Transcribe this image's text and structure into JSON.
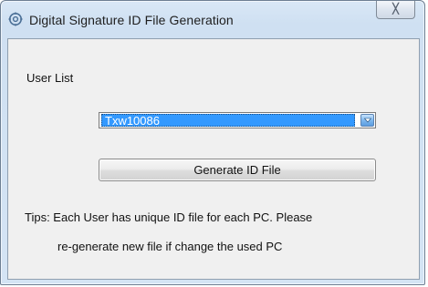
{
  "window": {
    "title": "Digital Signature ID File Generation",
    "title_icon": "gear-settings-icon",
    "close_label": "╳"
  },
  "form": {
    "user_list_label": "User List",
    "user_select": {
      "selected_value": "Txw10086"
    },
    "generate_button_label": "Generate ID File",
    "tips_line_1": "Tips: Each User has unique ID file for each PC. Please",
    "tips_line_2": "re-generate new file if change the used PC"
  },
  "colors": {
    "selection_highlight": "#3399ff",
    "client_background": "#f0f0f0",
    "title_bar": "#d4e4f4"
  }
}
